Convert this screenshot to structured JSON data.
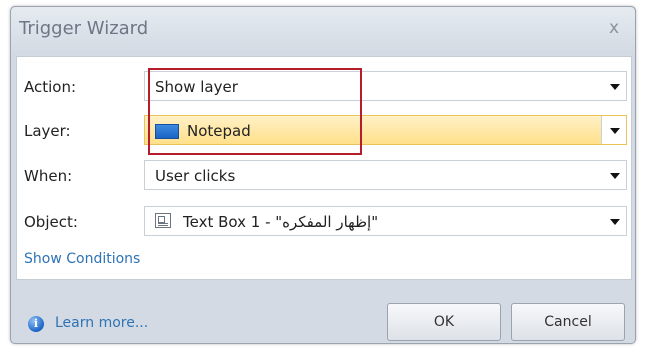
{
  "dialog": {
    "title": "Trigger Wizard",
    "close_label": "x"
  },
  "form": {
    "action": {
      "label": "Action:",
      "value": "Show layer"
    },
    "layer": {
      "label": "Layer:",
      "value": "Notepad",
      "swatch_color": "#1b63c4"
    },
    "when": {
      "label": "When:",
      "value": "User clicks"
    },
    "object": {
      "label": "Object:",
      "value": "Text Box 1 - \"إظهار المفكره\""
    }
  },
  "show_conditions": "Show Conditions",
  "footer": {
    "learn_more": "Learn more...",
    "ok_label": "OK",
    "cancel_label": "Cancel"
  },
  "colors": {
    "highlight": "#b71c2a",
    "link": "#2e74b5",
    "selected_row": "#ffe08a"
  }
}
